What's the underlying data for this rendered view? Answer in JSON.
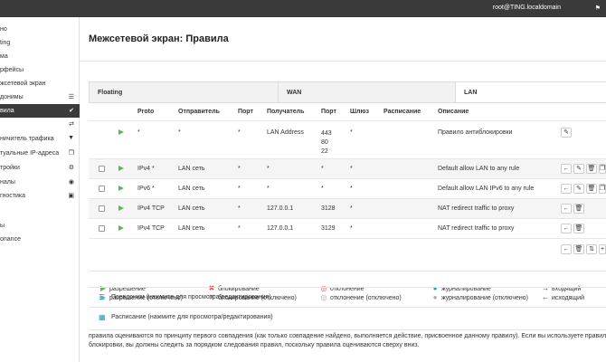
{
  "topbar": {
    "user": "root@TING.localdomain",
    "flag_icon": "flag-icon"
  },
  "sidebar": {
    "items": [
      {
        "label": "но",
        "icon": ""
      },
      {
        "label": "ting",
        "icon": ""
      },
      {
        "label": "ма",
        "icon": ""
      },
      {
        "label": "рфейсы",
        "icon": ""
      },
      {
        "label": "жсетевой экран",
        "icon": ""
      },
      {
        "label": "донимы",
        "icon": "list-icon"
      },
      {
        "label": "вила",
        "icon": "check-icon"
      },
      {
        "label": "",
        "icon": "exchange-icon"
      },
      {
        "label": "ничитель трафика",
        "icon": "filter-icon"
      },
      {
        "label": "туальные IP-адреса",
        "icon": "copy-icon"
      },
      {
        "label": "тройки",
        "icon": "cogs-icon"
      },
      {
        "label": "налы",
        "icon": "eye-icon"
      },
      {
        "label": "гностика",
        "icon": "medkit-icon"
      },
      {
        "label": "",
        "icon": ""
      },
      {
        "label": "ы",
        "icon": ""
      },
      {
        "label": "onance",
        "icon": ""
      }
    ]
  },
  "page": {
    "title": "Межсетевой экран: Правила"
  },
  "tabs": [
    "Floating",
    "WAN",
    "LAN"
  ],
  "table": {
    "headers": [
      "Proto",
      "Отправитель",
      "Порт",
      "Получатель",
      "Порт",
      "Шлюз",
      "Расписание",
      "Описание"
    ],
    "rows": [
      {
        "checkbox": false,
        "proto": "*",
        "src": "*",
        "sport": "*",
        "dst": "LAN Address",
        "dport": "443\n80\n22",
        "gw": "*",
        "sched": "",
        "desc": "Правило антиблокировки"
      },
      {
        "checkbox": true,
        "proto": "IPv4 *",
        "src": "LAN сеть",
        "sport": "*",
        "dst": "*",
        "dport": "*",
        "gw": "*",
        "sched": "",
        "desc": "Default allow LAN to any rule"
      },
      {
        "checkbox": true,
        "proto": "IPv6 *",
        "src": "LAN сеть",
        "sport": "*",
        "dst": "*",
        "dport": "*",
        "gw": "*",
        "sched": "",
        "desc": "Default allow LAN IPv6 to any rule"
      },
      {
        "checkbox": true,
        "proto": "IPv4 TCP",
        "src": "LAN сеть",
        "sport": "*",
        "dst": "127.0.0.1",
        "dport": "3128",
        "gw": "*",
        "sched": "",
        "desc": "NAT redirect traffic to proxy"
      },
      {
        "checkbox": true,
        "proto": "IPv4 TCP",
        "src": "LAN сеть",
        "sport": "*",
        "dst": "127.0.0.1",
        "dport": "3129",
        "gw": "*",
        "sched": "",
        "desc": "NAT redirect traffic to proxy"
      }
    ]
  },
  "legend": {
    "pass": "разрешение",
    "pass_disabled": "разрешение (отключено)",
    "block": "блокирование",
    "block_disabled": "блокирование (отключено)",
    "reject": "отклонение",
    "reject_disabled": "отклонение (отключено)",
    "log": "журналирование",
    "log_disabled": "журналирование (отключено)",
    "in": "входящий",
    "out": "исходящий",
    "arrow_in": "→",
    "arrow_out": "←"
  },
  "alias_link": "Псевдоним (нажмите для просмотра/редактирования)",
  "schedule_link": "Расписание (нажмите для просмотра/редактирования)",
  "note_line1": "правила оцениваются по принципу первого совпадения (как только совпадение найдено, выполняется действие, присвоенное данному правилу). Если вы используете правила",
  "note_line2": "блокировки, вы должны следить за порядком следования правил, поскольку правила оцениваются сверху вниз.",
  "colors": {
    "topbar": "#3a3a3a",
    "pass": "#5cb85c",
    "block": "#d9534f",
    "info": "#17a2b8"
  }
}
